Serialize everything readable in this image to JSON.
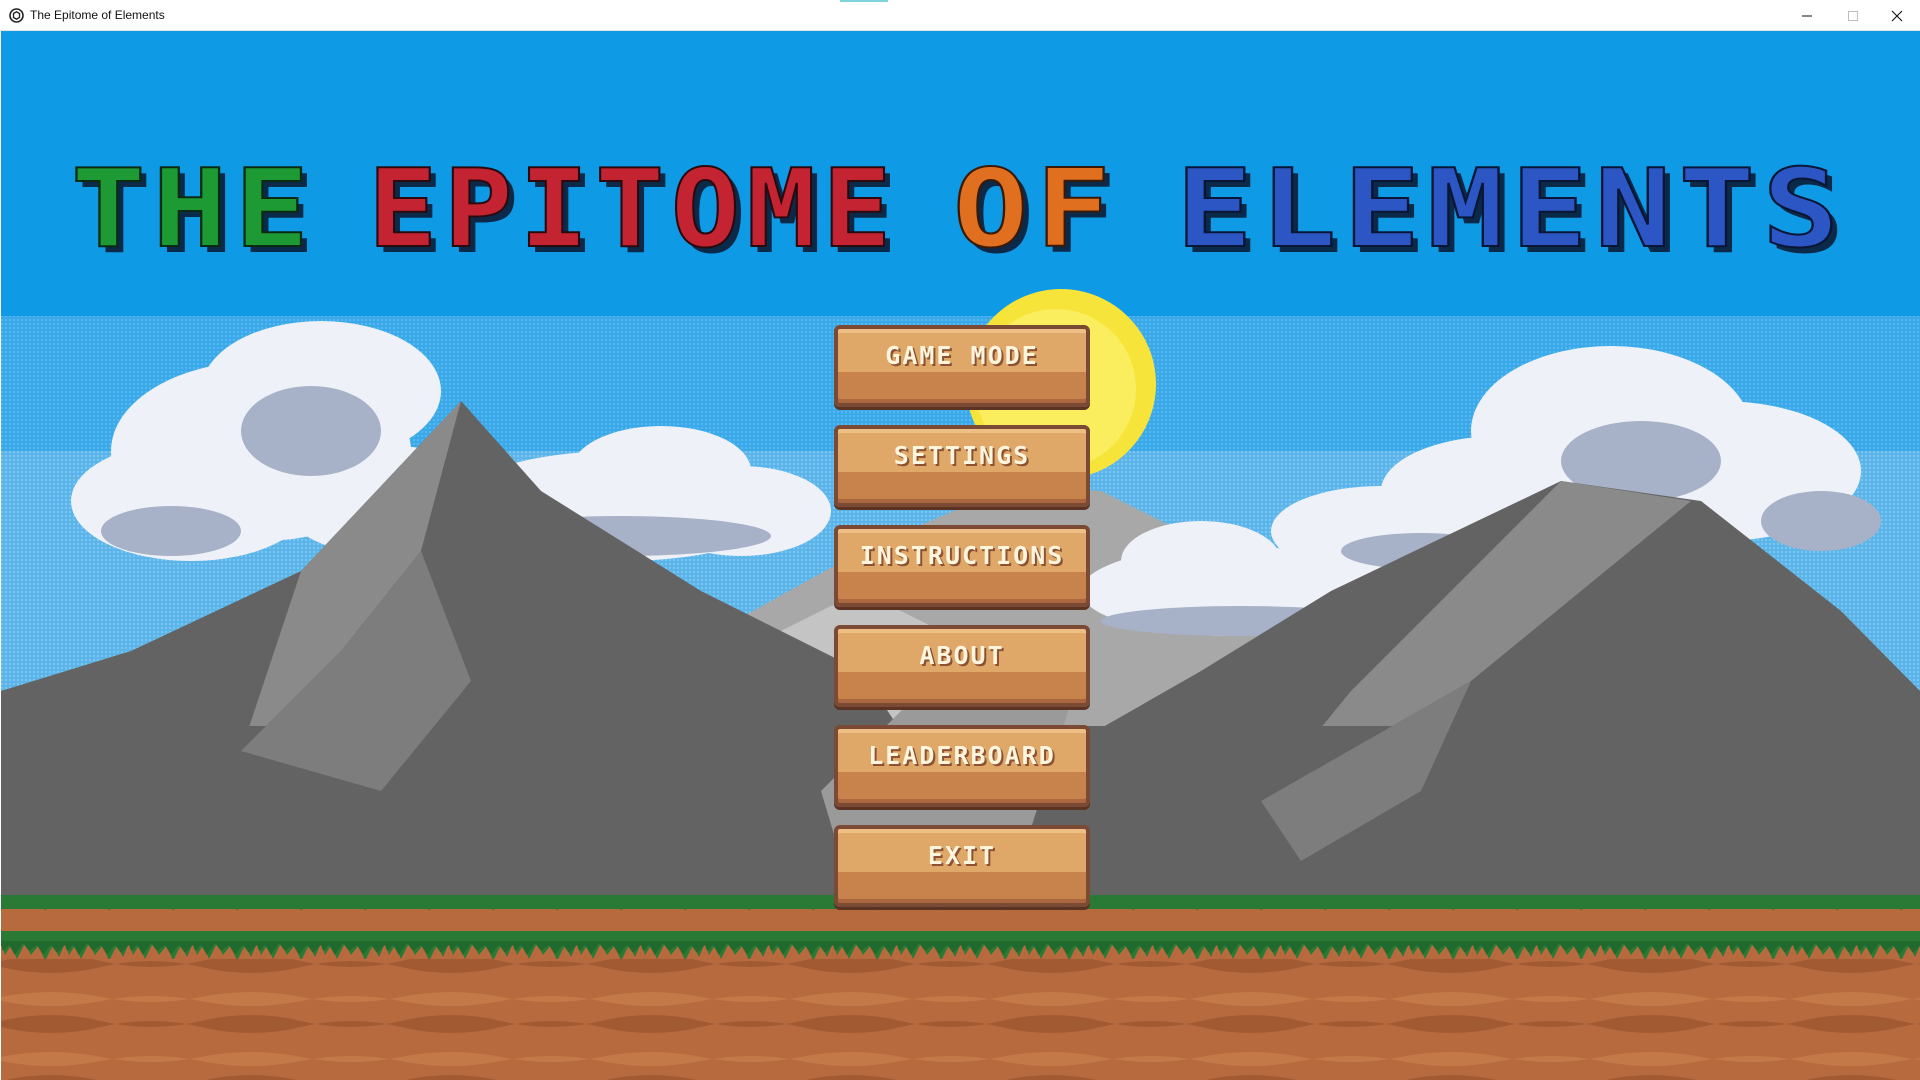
{
  "window": {
    "title": "The Epitome of Elements",
    "controls": [
      "minimize",
      "maximize",
      "close"
    ]
  },
  "game": {
    "title_words": [
      {
        "text": "THE",
        "color": "#1e9a35"
      },
      {
        "text": "EPITOME",
        "color": "#c42432"
      },
      {
        "text": "OF",
        "color": "#e07020"
      },
      {
        "text": "ELEMENTS",
        "color": "#2c56c4"
      }
    ],
    "menu": [
      {
        "label": "GAME MODE"
      },
      {
        "label": "SETTINGS"
      },
      {
        "label": "INSTRUCTIONS"
      },
      {
        "label": "ABOUT"
      },
      {
        "label": "LEADERBOARD"
      },
      {
        "label": "EXIT"
      }
    ]
  },
  "colors": {
    "sky": "#0f9ae6",
    "mountain_dark": "#636363",
    "mountain_light": "#8a8a8a",
    "grass": "#2a7a36",
    "dirt": "#b66a3e",
    "sun": "#f7e43a",
    "button": "#dfa868"
  }
}
